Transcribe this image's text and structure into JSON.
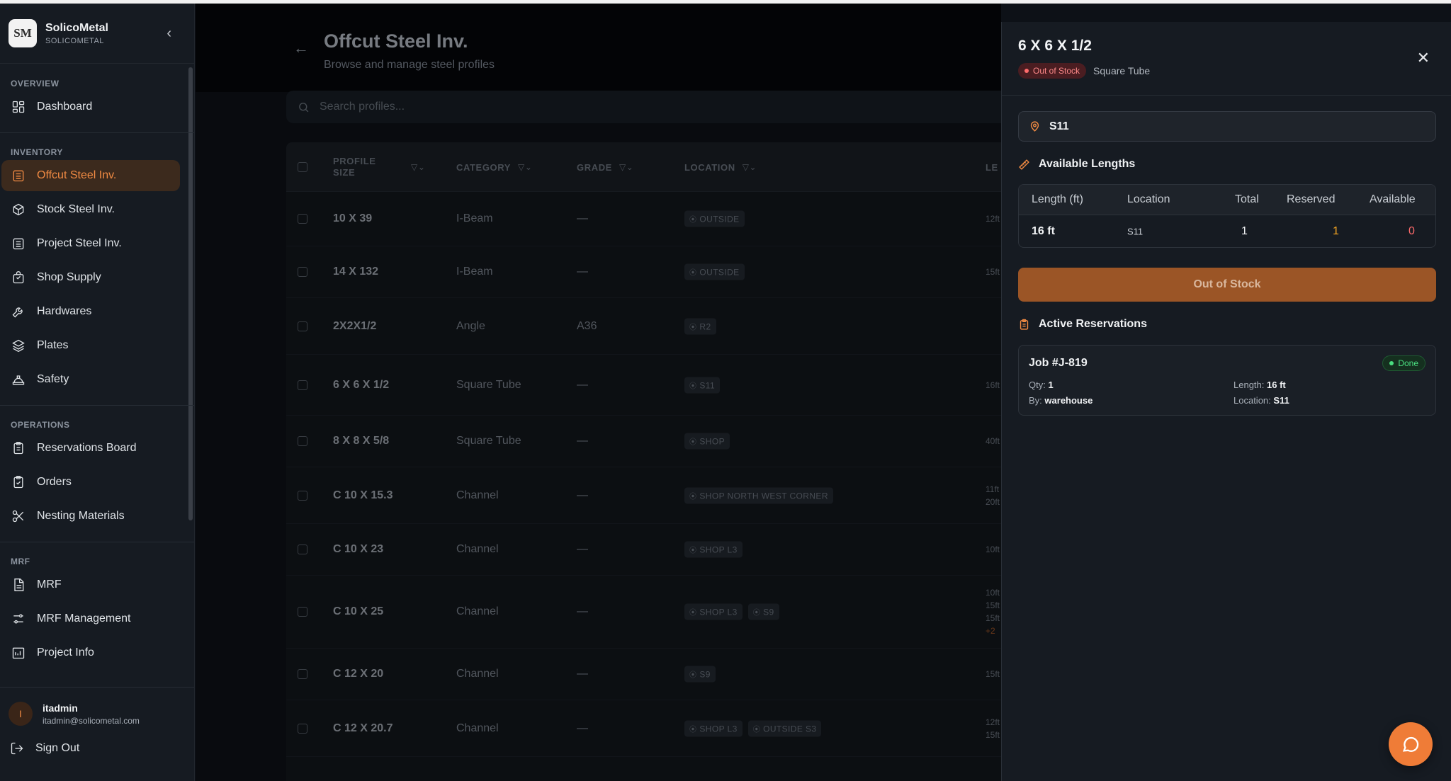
{
  "app": {
    "name": "SolicoMetal",
    "subtitle": "SOLICOMETAL",
    "logo_text": "SM"
  },
  "sidebar": {
    "sections": [
      {
        "label": "OVERVIEW",
        "items": [
          {
            "label": "Dashboard",
            "icon": "dashboard-icon"
          }
        ]
      },
      {
        "label": "INVENTORY",
        "items": [
          {
            "label": "Offcut Steel Inv.",
            "icon": "inventory-icon",
            "active": true
          },
          {
            "label": "Stock Steel Inv.",
            "icon": "package-icon"
          },
          {
            "label": "Project Steel Inv.",
            "icon": "inventory-icon"
          },
          {
            "label": "Shop Supply",
            "icon": "shopping-bag-icon"
          },
          {
            "label": "Hardwares",
            "icon": "wrench-icon"
          },
          {
            "label": "Plates",
            "icon": "layers-icon"
          },
          {
            "label": "Safety",
            "icon": "hard-hat-icon"
          }
        ]
      },
      {
        "label": "OPERATIONS",
        "items": [
          {
            "label": "Reservations Board",
            "icon": "clipboard-icon"
          },
          {
            "label": "Orders",
            "icon": "clipboard-check-icon"
          },
          {
            "label": "Nesting Materials",
            "icon": "scissors-icon"
          }
        ]
      },
      {
        "label": "MRF",
        "items": [
          {
            "label": "MRF",
            "icon": "file-icon"
          },
          {
            "label": "MRF Management",
            "icon": "sliders-icon"
          },
          {
            "label": "Project Info",
            "icon": "building-icon"
          }
        ]
      }
    ],
    "user": {
      "initial": "I",
      "name": "itadmin",
      "email": "itadmin@solicometal.com"
    },
    "sign_out": "Sign Out"
  },
  "main": {
    "title": "Offcut Steel Inv.",
    "subtitle": "Browse and manage steel profiles",
    "search_placeholder": "Search profiles...",
    "columns": {
      "size": "PROFILE SIZE",
      "category": "CATEGORY",
      "grade": "GRADE",
      "location": "LOCATION",
      "lengths": "LE"
    },
    "rows": [
      {
        "size": "10 X 39",
        "category": "I-Beam",
        "grade": "—",
        "locations": [
          "OUTSIDE"
        ],
        "lengths": [
          "12ft"
        ],
        "more": ""
      },
      {
        "size": "14 X 132",
        "category": "I-Beam",
        "grade": "—",
        "locations": [
          "OUTSIDE"
        ],
        "lengths": [
          "15ft"
        ],
        "more": ""
      },
      {
        "size": "2X2X1/2",
        "category": "Angle",
        "grade": "A36",
        "locations": [
          "R2"
        ],
        "lengths": [],
        "more": ""
      },
      {
        "size": "6 X 6 X 1/2",
        "category": "Square Tube",
        "grade": "—",
        "locations": [
          "S11"
        ],
        "lengths": [
          "16ft"
        ],
        "more": ""
      },
      {
        "size": "8 X 8 X 5/8",
        "category": "Square Tube",
        "grade": "—",
        "locations": [
          "SHOP"
        ],
        "lengths": [
          "40ft"
        ],
        "more": ""
      },
      {
        "size": "C 10 X 15.3",
        "category": "Channel",
        "grade": "—",
        "locations": [
          "SHOP NORTH WEST CORNER"
        ],
        "lengths": [
          "11ft",
          "20ft"
        ],
        "more": ""
      },
      {
        "size": "C 10 X 23",
        "category": "Channel",
        "grade": "—",
        "locations": [
          "SHOP L3"
        ],
        "lengths": [
          "10ft"
        ],
        "more": ""
      },
      {
        "size": "C 10 X 25",
        "category": "Channel",
        "grade": "—",
        "locations": [
          "SHOP L3",
          "S9"
        ],
        "lengths": [
          "10ft",
          "15ft",
          "15ft"
        ],
        "more": "+2"
      },
      {
        "size": "C 12 X 20",
        "category": "Channel",
        "grade": "—",
        "locations": [
          "S9"
        ],
        "lengths": [
          "15ft"
        ],
        "more": ""
      },
      {
        "size": "C 12 X 20.7",
        "category": "Channel",
        "grade": "—",
        "locations": [
          "SHOP L3",
          "OUTSIDE S3"
        ],
        "lengths": [
          "12ft",
          "15ft"
        ],
        "more": ""
      }
    ]
  },
  "drawer": {
    "title": "6 X 6 X 1/2",
    "status": "Out of Stock",
    "category": "Square Tube",
    "location": "S11",
    "lengths_heading": "Available Lengths",
    "lengths_columns": [
      "Length (ft)",
      "Location",
      "Total",
      "Reserved",
      "Available"
    ],
    "lengths_rows": [
      {
        "length": "16 ft",
        "location": "S11",
        "total": "1",
        "reserved": "1",
        "available": "0"
      }
    ],
    "action_label": "Out of Stock",
    "reservations_heading": "Active Reservations",
    "reservations": [
      {
        "job": "Job #J-819",
        "status": "Done",
        "qty_label": "Qty:",
        "qty": "1",
        "by_label": "By:",
        "by": "warehouse",
        "length_label": "Length:",
        "length": "16 ft",
        "location_label": "Location:",
        "location": "S11"
      }
    ]
  },
  "colors": {
    "accent": "#f08a43",
    "danger": "#ff6b6b",
    "success": "#4ade80",
    "reserved": "#f5a623"
  }
}
